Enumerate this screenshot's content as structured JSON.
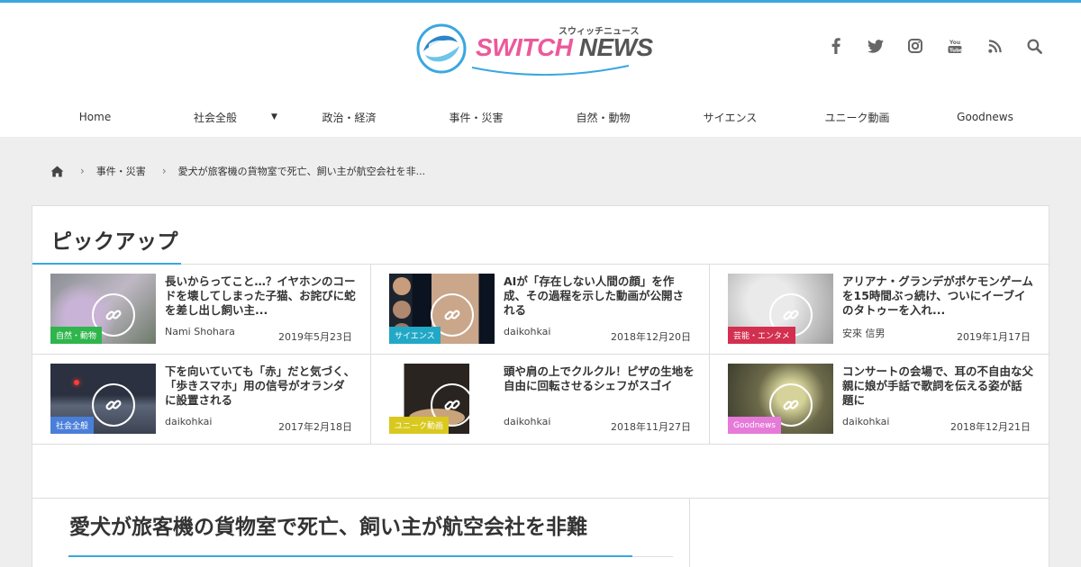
{
  "site": {
    "brand_switch": "SWITCH",
    "brand_news": "NEWS",
    "brand_kana": "スウィッチニュース",
    "accent_color": "#3aa7e0",
    "logo_pink": "#ec5a9b"
  },
  "social_icons": [
    "facebook-icon",
    "twitter-icon",
    "instagram-icon",
    "youtube-icon",
    "rss-icon",
    "search-icon"
  ],
  "nav": {
    "items": [
      "Home",
      "社会全般",
      "政治・経済",
      "事件・災害",
      "自然・動物",
      "サイエンス",
      "ユニーク動画",
      "Goodnews"
    ]
  },
  "breadcrumb": {
    "category": "事件・災害",
    "current": "愛犬が旅客機の貨物室で死亡、飼い主が航空会社を非..."
  },
  "pickup": {
    "heading": "ピックアップ",
    "cards": [
      {
        "title": "長いからってこと…？イヤホンのコードを壊してしまった子猫、お詫びに蛇を差し出し飼い主...",
        "author": "Nami Shohara",
        "date": "2019年5月23日",
        "category": "自然・動物",
        "category_color": "#2eb54c"
      },
      {
        "title": "AIが「存在しない人間の顔」を作成、その過程を示した動画が公開される",
        "author": "daikohkai",
        "date": "2018年12月20日",
        "category": "サイエンス",
        "category_color": "#22a8c7"
      },
      {
        "title": "アリアナ・グランデがポケモンゲームを15時間ぶっ続け、ついにイーブイのタトゥーを入れ...",
        "author": "安來 信男",
        "date": "2019年1月17日",
        "category": "芸能・エンタメ",
        "category_color": "#d32f4f"
      },
      {
        "title": "下を向いていても「赤」だと気づく、「歩きスマホ」用の信号がオランダに設置される",
        "author": "daikohkai",
        "date": "2017年2月18日",
        "category": "社会全般",
        "category_color": "#4a7fd9"
      },
      {
        "title": "頭や肩の上でクルクル！ピザの生地を自由に回転させるシェフがスゴイ",
        "author": "daikohkai",
        "date": "2018年11月27日",
        "category": "ユニーク動画",
        "category_color": "#d9c91f"
      },
      {
        "title": "コンサートの会場で、耳の不自由な父親に娘が手話で歌詞を伝える姿が話題に",
        "author": "daikohkai",
        "date": "2018年12月21日",
        "category": "Goodnews",
        "category_color": "#e67ad9"
      }
    ]
  },
  "article": {
    "title": "愛犬が旅客機の貨物室で死亡、飼い主が航空会社を非難"
  }
}
